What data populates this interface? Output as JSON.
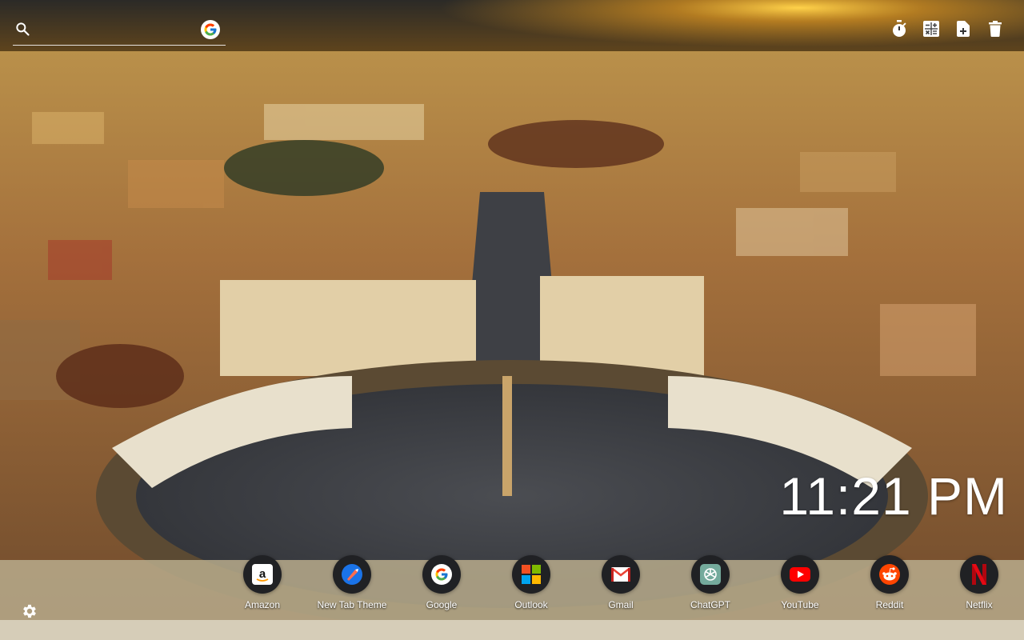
{
  "search": {
    "placeholder": "",
    "engine_icon": "google-logo"
  },
  "toolbar": {
    "items": [
      {
        "icon": "stopwatch-icon"
      },
      {
        "icon": "calculator-icon"
      },
      {
        "icon": "note-add-icon"
      },
      {
        "icon": "trash-icon"
      }
    ]
  },
  "clock": {
    "time": "11:21 PM"
  },
  "shortcuts": [
    {
      "label": "Amazon",
      "icon": "amazon-icon",
      "color": "#ffffff"
    },
    {
      "label": "New Tab Theme",
      "icon": "new-tab-theme-icon",
      "color": "#1a73e8"
    },
    {
      "label": "Google",
      "icon": "google-icon",
      "color": "#4285f4"
    },
    {
      "label": "Outlook",
      "icon": "microsoft-icon",
      "color": "#f25022"
    },
    {
      "label": "Gmail",
      "icon": "gmail-icon",
      "color": "#ea4335"
    },
    {
      "label": "ChatGPT",
      "icon": "chatgpt-icon",
      "color": "#74aa9c"
    },
    {
      "label": "YouTube",
      "icon": "youtube-icon",
      "color": "#ff0000"
    },
    {
      "label": "Reddit",
      "icon": "reddit-icon",
      "color": "#ff4500"
    },
    {
      "label": "Netflix",
      "icon": "netflix-icon",
      "color": "#e50914"
    }
  ],
  "settings": {
    "icon": "gear-icon"
  }
}
